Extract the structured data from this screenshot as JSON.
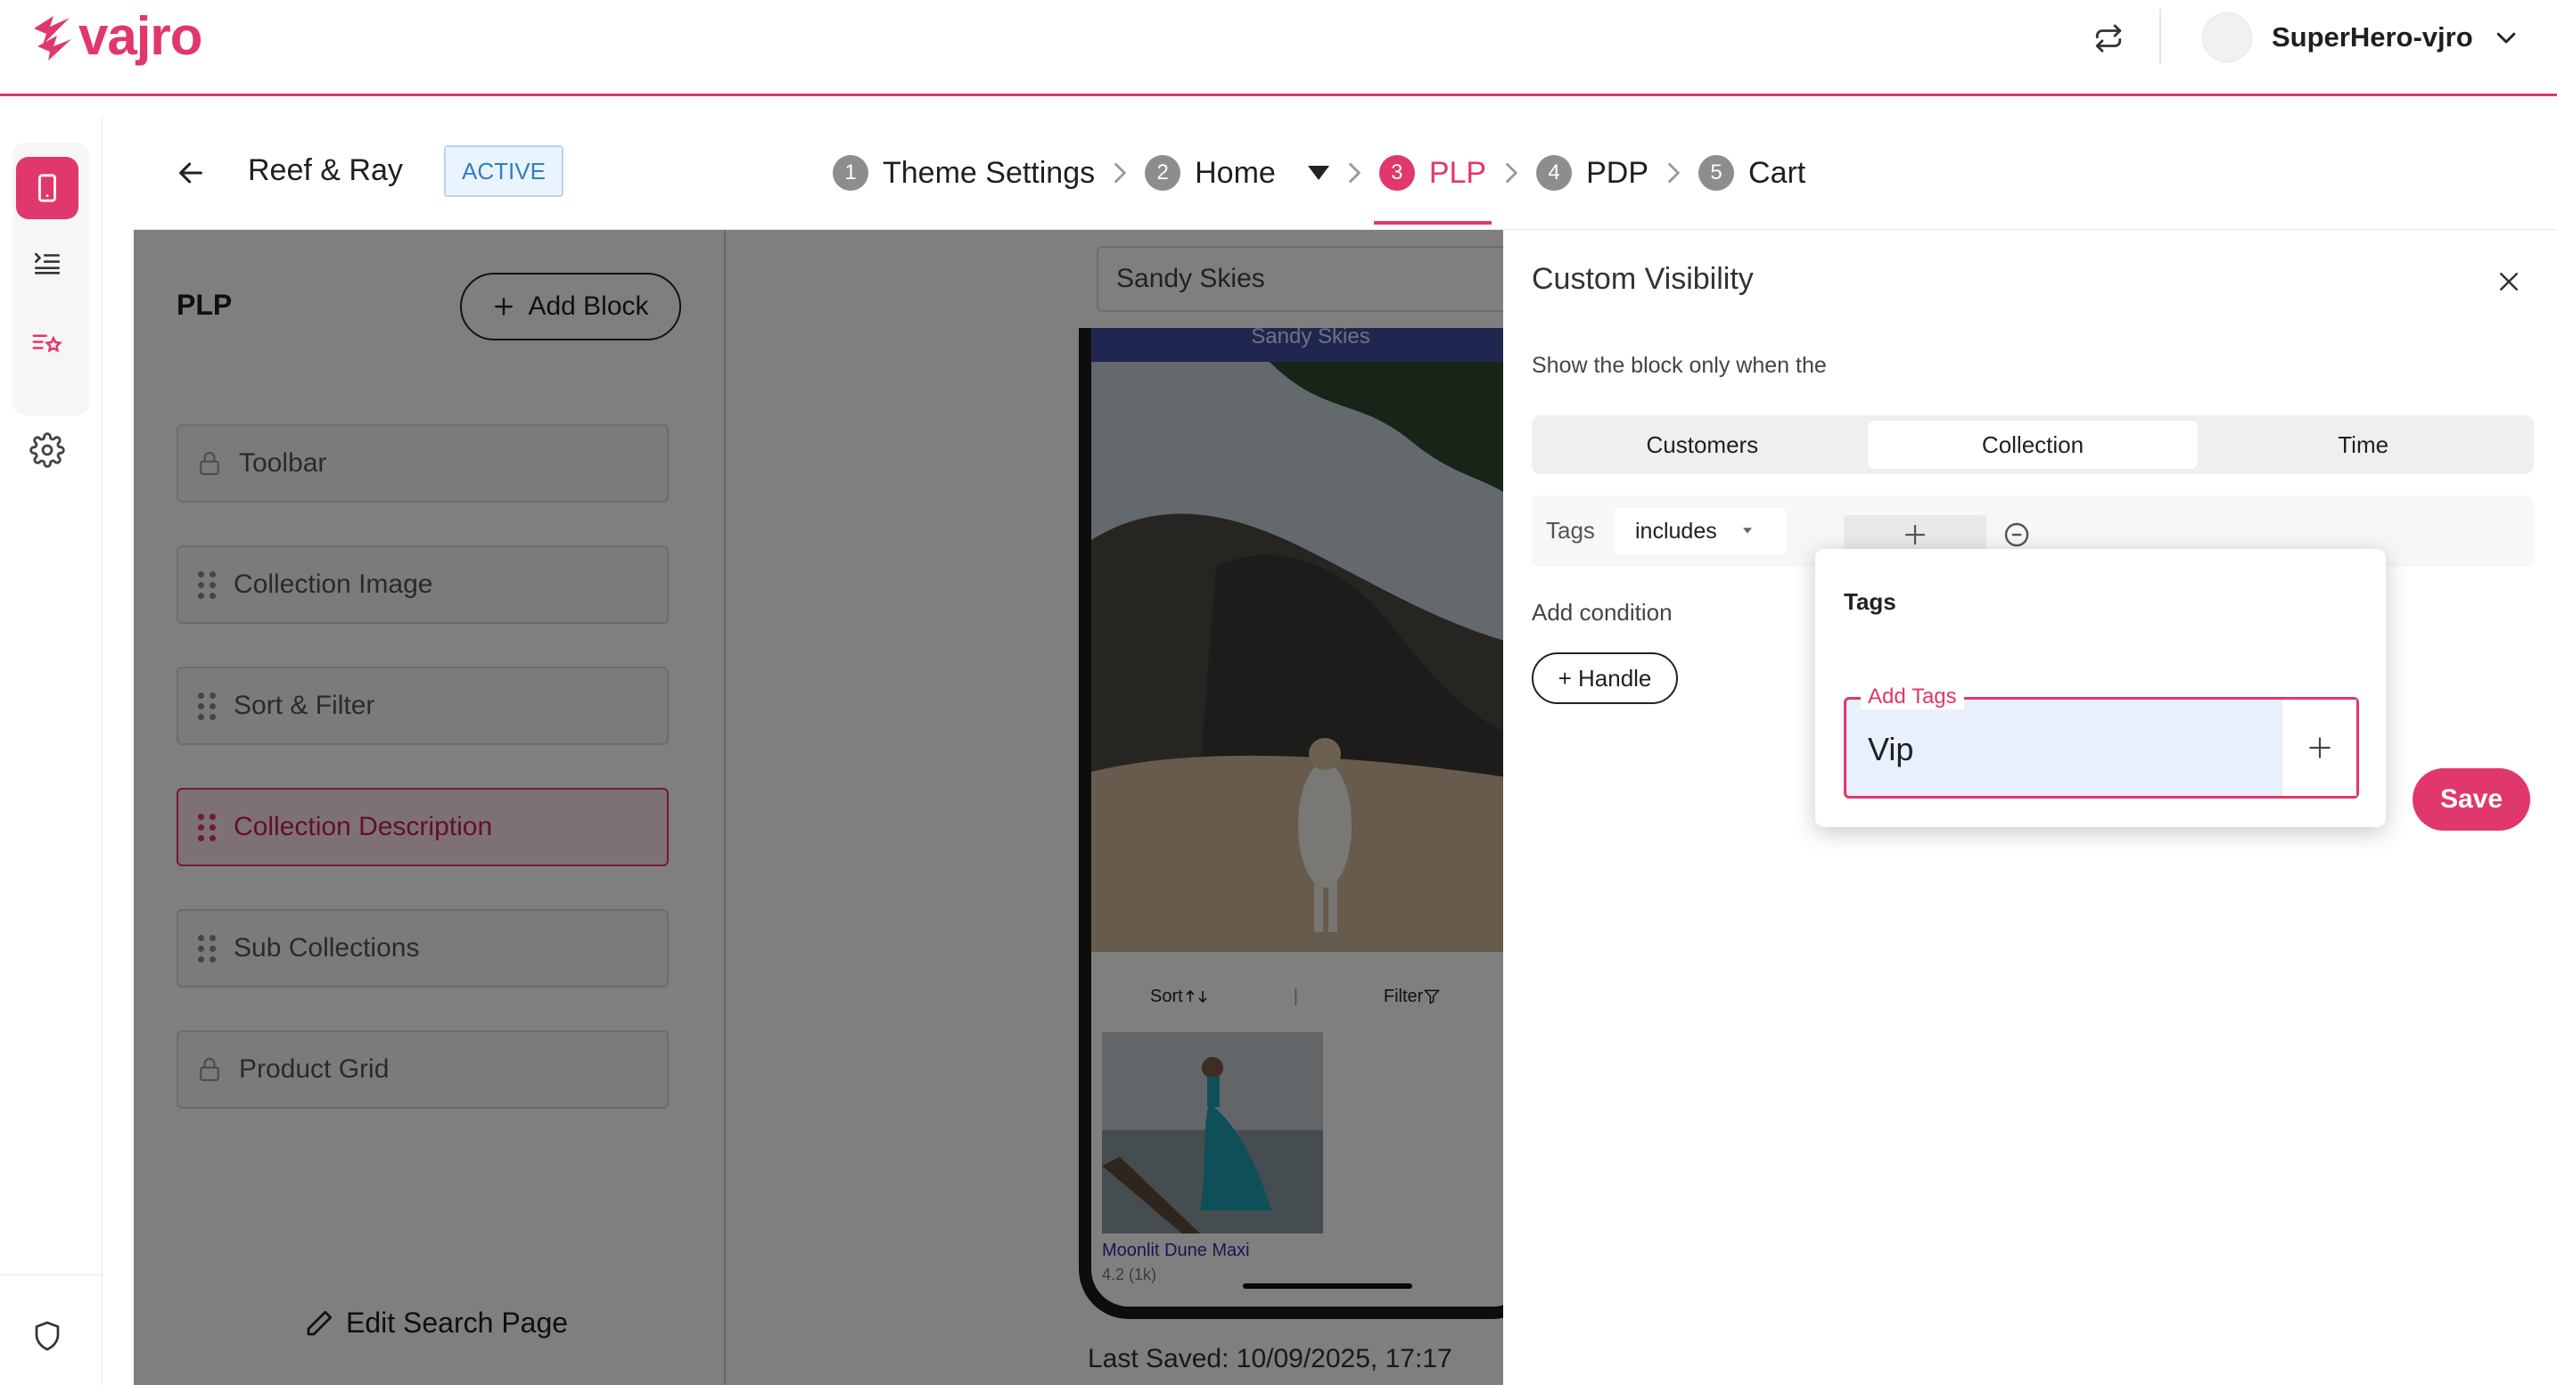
{
  "topbar": {
    "logo_text": "vajro",
    "account_name": "SuperHero-vjro"
  },
  "header": {
    "store_name": "Reef & Ray",
    "status": "ACTIVE",
    "steps": [
      {
        "num": "1",
        "label": "Theme Settings"
      },
      {
        "num": "2",
        "label": "Home"
      },
      {
        "num": "3",
        "label": "PLP"
      },
      {
        "num": "4",
        "label": "PDP"
      },
      {
        "num": "5",
        "label": "Cart"
      }
    ]
  },
  "blocks_panel": {
    "title": "PLP",
    "add_block_label": "Add Block",
    "blocks": [
      {
        "label": "Toolbar",
        "icon": "lock-icon"
      },
      {
        "label": "Collection Image",
        "icon": "drag-handle-icon"
      },
      {
        "label": "Sort & Filter",
        "icon": "drag-handle-icon"
      },
      {
        "label": "Collection Description",
        "icon": "drag-handle-icon"
      },
      {
        "label": "Sub Collections",
        "icon": "drag-handle-icon"
      },
      {
        "label": "Product Grid",
        "icon": "lock-icon"
      }
    ],
    "edit_search_label": "Edit Search Page"
  },
  "preview": {
    "search_value": "Sandy Skies",
    "phone_header": "Sandy Skies",
    "sort_label": "Sort",
    "divider": "|",
    "filter_label": "Filter",
    "product_name": "Moonlit Dune Maxi",
    "product_rating": "4.2 (1k)",
    "last_saved": "Last Saved:  10/09/2025, 17:17"
  },
  "drawer": {
    "title": "Custom Visibility",
    "description": "Show the block only when the",
    "tabs": [
      "Customers",
      "Collection",
      "Time"
    ],
    "active_tab": "Collection",
    "condition": {
      "field": "Tags",
      "operator": "includes"
    },
    "add_condition_label": "Add condition",
    "handle_button": "+ Handle",
    "save_label": "Save"
  },
  "tags_popover": {
    "title": "Tags",
    "field_label": "Add Tags",
    "value": "Vip"
  },
  "colors": {
    "accent": "#e0376c",
    "badge_text": "#2f7ec5",
    "badge_bg": "#eaf4fe"
  }
}
